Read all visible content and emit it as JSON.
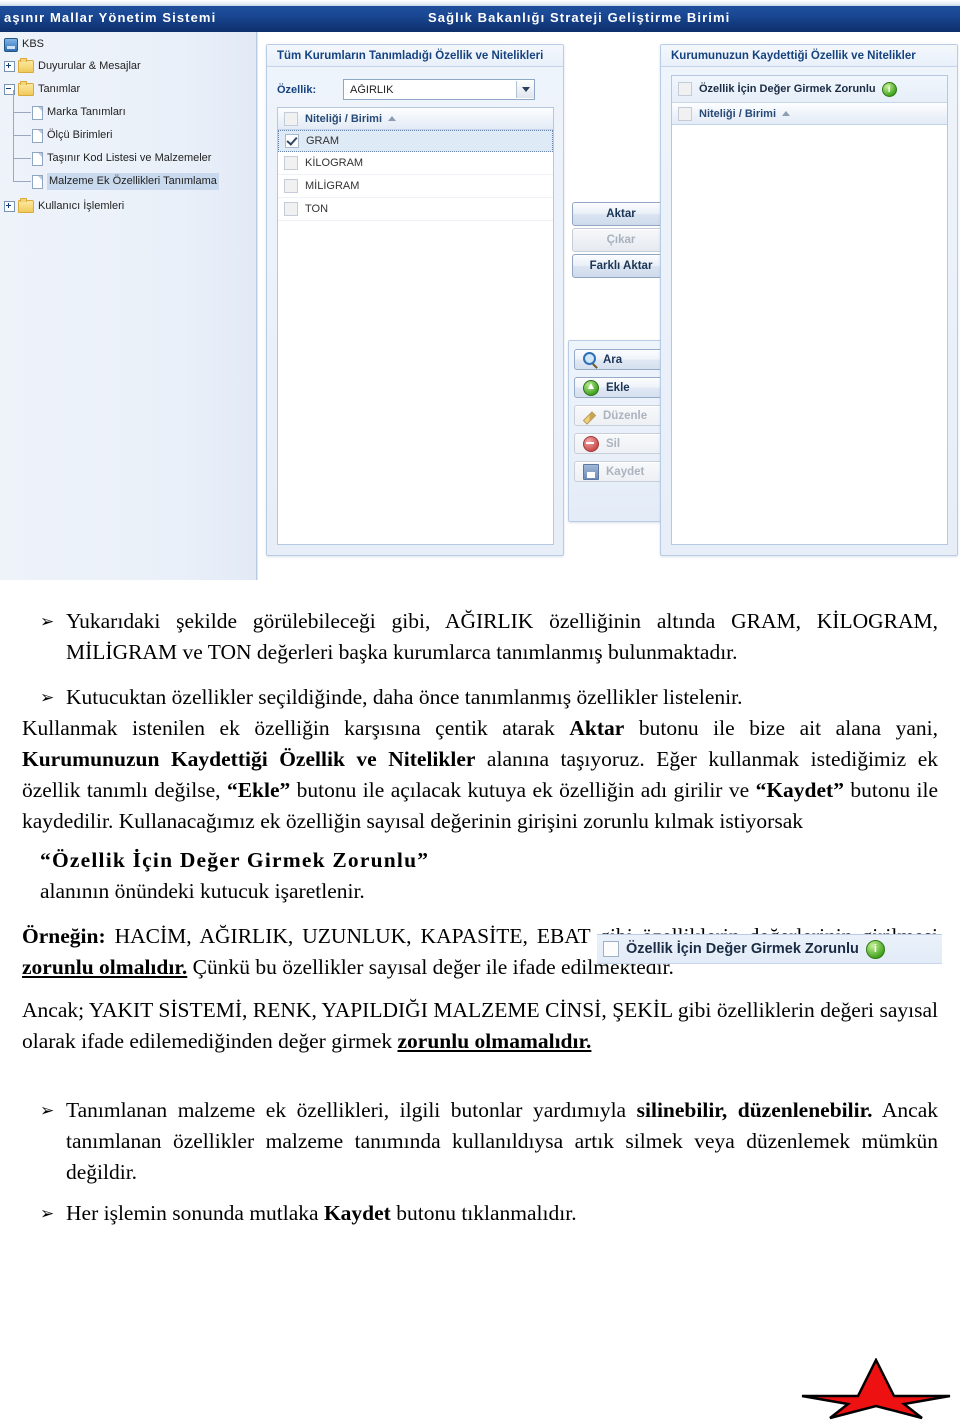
{
  "app": {
    "title_left": "aşınır Mallar Yönetim Sistemi",
    "title_center": "Sağlık Bakanlığı Strateji Geliştirme Birimi",
    "tree": {
      "root_label": "KBS",
      "items": [
        {
          "label": "Duyurular & Mesajlar",
          "icon": "folder-icon",
          "expander": "plus",
          "depth": 0
        },
        {
          "label": "Tanımlar",
          "icon": "folder-icon",
          "expander": "minus",
          "depth": 0
        },
        {
          "label": "Marka Tanımları",
          "icon": "document-icon",
          "expander": "none",
          "depth": 1
        },
        {
          "label": "Ölçü Birimleri",
          "icon": "document-icon",
          "expander": "none",
          "depth": 1
        },
        {
          "label": "Taşınır Kod Listesi ve Malzemeler",
          "icon": "document-icon",
          "expander": "none",
          "depth": 1
        },
        {
          "label": "Malzeme Ek Özellikleri Tanımlama",
          "icon": "document-icon",
          "expander": "none",
          "depth": 1,
          "selected": true
        },
        {
          "label": "Kullanıcı İşlemleri",
          "icon": "folder-icon",
          "expander": "plus",
          "depth": 0
        }
      ]
    },
    "left_panel": {
      "title": "Tüm Kurumların Tanımladığı Özellik ve Nitelikleri",
      "field_label": "Özellik:",
      "field_value": "AĞIRLIK",
      "grid_header": "Niteliği / Birimi",
      "sort_direction": "ascending",
      "rows": [
        {
          "label": "GRAM",
          "checked": true,
          "selected": true
        },
        {
          "label": "KİLOGRAM",
          "checked": false,
          "selected": false
        },
        {
          "label": "MİLİGRAM",
          "checked": false,
          "selected": false
        },
        {
          "label": "TON",
          "checked": false,
          "selected": false
        }
      ]
    },
    "right_panel": {
      "title": "Kurumunuzun Kaydettiği Özellik ve Nitelikler",
      "mandatory_label": "Özellik İçin Değer Girmek Zorunlu",
      "mandatory_checked": false,
      "info_badge": "i",
      "grid_header": "Niteliği / Birimi",
      "rows": []
    },
    "transfer_buttons": [
      {
        "label": "Aktar",
        "enabled": true
      },
      {
        "label": "Çıkar",
        "enabled": false
      },
      {
        "label": "Farklı Aktar",
        "enabled": true
      }
    ],
    "action_buttons": [
      {
        "label": "Ara",
        "icon": "search-icon",
        "enabled": true
      },
      {
        "label": "Ekle",
        "icon": "add-icon",
        "enabled": true
      },
      {
        "label": "Düzenle",
        "icon": "edit-icon",
        "enabled": false
      },
      {
        "label": "Sil",
        "icon": "delete-icon",
        "enabled": false
      },
      {
        "label": "Kaydet",
        "icon": "save-icon",
        "enabled": false
      }
    ]
  },
  "document": {
    "bullet_marker": "➢",
    "bullet_1": "Yukarıdaki şekilde görülebileceği gibi, AĞIRLIK özelliğinin altında GRAM, KİLOGRAM, MİLİGRAM ve TON değerleri başka kurumlarca tanımlanmış bulunmaktadır.",
    "bullet_2_lead": "Kutucuktan özellikler seçildiğinde, daha önce tanımlanmış özellikler listelenir.",
    "para_2a": "Kullanmak istenilen ek özelliğin karşısına çentik atarak ",
    "para_2a_b1": "Aktar",
    "para_2b": " butonu ile bize ait alana yani, ",
    "para_2a_b2": "Kurumunuzun Kaydettiği Özellik ve Nitelikler",
    "para_2c": " alanına taşıyoruz. Eğer kullanmak istediğimiz ek özellik tanımlı değilse, ",
    "para_2a_b3": "“Ekle”",
    "para_2d": " butonu ile açılacak kutuya ek özelliğin adı girilir ve ",
    "para_2a_b4": "“Kaydet”",
    "para_2e": " butonu ile kaydedilir. Kullanacağımız ek özelliğin sayısal değerinin girişini zorunlu kılmak istiyorsak",
    "para_3_bold": "“Özellik İçin Değer Girmek Zorunlu”",
    "para_3_rest": "alanının önündeki kutucuk işaretlenir.",
    "para_4_lead": "Örneğin:",
    "para_4a": " HACİM, AĞIRLIK, UZUNLUK, KAPASİTE, EBAT gibi özelliklerin değerlerinin girilmesi ",
    "para_4_bu": "zorunlu olmalıdır.",
    "para_4b": " Çünkü bu özellikler sayısal değer ile ifade edilmektedir.",
    "para_5a": "Ancak; YAKIT SİSTEMİ, RENK, YAPILDIĞI MALZEME CİNSİ, ŞEKİL gibi özelliklerin değeri sayısal olarak ifade edilemediğinden değer girmek ",
    "para_5_bu": "zorunlu olmamalıdır.",
    "bullet_3a": "Tanımlanan malzeme ek özellikleri, ilgili butonlar yardımıyla ",
    "bullet_3_b": "silinebilir, düzenlenebilir.",
    "bullet_3b": " Ancak tanımlanan özellikler malzeme tanımında kullanıldıysa artık silmek veya düzenlemek mümkün değildir.",
    "bullet_4a": "Her işlemin sonunda mutlaka ",
    "bullet_4_b": "Kaydet",
    "bullet_4b": " butonu tıklanmalıdır.",
    "inline_snippet": {
      "label": "Özellik İçin Değer Girmek Zorunlu",
      "info_badge": "i",
      "checked": false
    },
    "star": {
      "color": "#ee1111",
      "outline": "#000000"
    }
  }
}
